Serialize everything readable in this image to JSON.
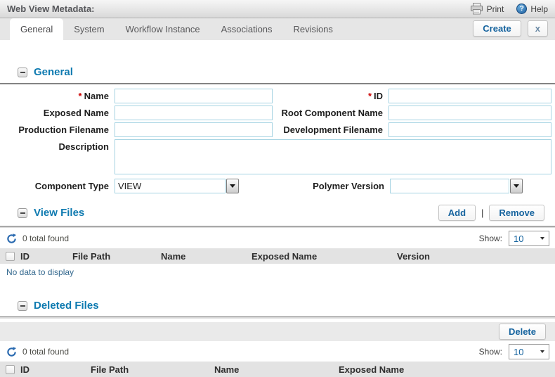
{
  "colors": {
    "section_title": "#0e7ab0",
    "button_text": "#15639e",
    "required_marker": "#cc0000",
    "input_border": "#a5d3e2",
    "empty_text": "#33688e",
    "table_header_bg": "#e3e3e3"
  },
  "header": {
    "title": "Web View Metadata:",
    "print_label": "Print",
    "help_label": "Help",
    "help_glyph": "?"
  },
  "tabs": {
    "items": [
      {
        "label": "General",
        "active": true
      },
      {
        "label": "System",
        "active": false
      },
      {
        "label": "Workflow Instance",
        "active": false
      },
      {
        "label": "Associations",
        "active": false
      },
      {
        "label": "Revisions",
        "active": false
      }
    ],
    "create_label": "Create",
    "close_label": "x"
  },
  "general": {
    "title": "General",
    "required_marker": "*",
    "fields": {
      "name": {
        "label": "Name",
        "value": "",
        "required": true
      },
      "id": {
        "label": "ID",
        "value": "",
        "required": true
      },
      "exposed_name": {
        "label": "Exposed Name",
        "value": ""
      },
      "root_component_name": {
        "label": "Root Component Name",
        "value": ""
      },
      "production_filename": {
        "label": "Production Filename",
        "value": ""
      },
      "development_filename": {
        "label": "Development Filename",
        "value": ""
      },
      "description": {
        "label": "Description",
        "value": ""
      },
      "component_type": {
        "label": "Component Type",
        "value": "VIEW"
      },
      "polymer_version": {
        "label": "Polymer Version",
        "value": ""
      }
    }
  },
  "view_files": {
    "title": "View Files",
    "add_label": "Add",
    "button_separator": "|",
    "remove_label": "Remove",
    "total_found": "0 total found",
    "show_label": "Show:",
    "show_value": "10",
    "columns": [
      "ID",
      "File Path",
      "Name",
      "Exposed Name",
      "Version"
    ],
    "empty_text": "No data to display"
  },
  "deleted_files": {
    "title": "Deleted Files",
    "delete_label": "Delete",
    "total_found": "0 total found",
    "show_label": "Show:",
    "show_value": "10",
    "columns": [
      "ID",
      "File Path",
      "Name",
      "Exposed Name"
    ]
  }
}
